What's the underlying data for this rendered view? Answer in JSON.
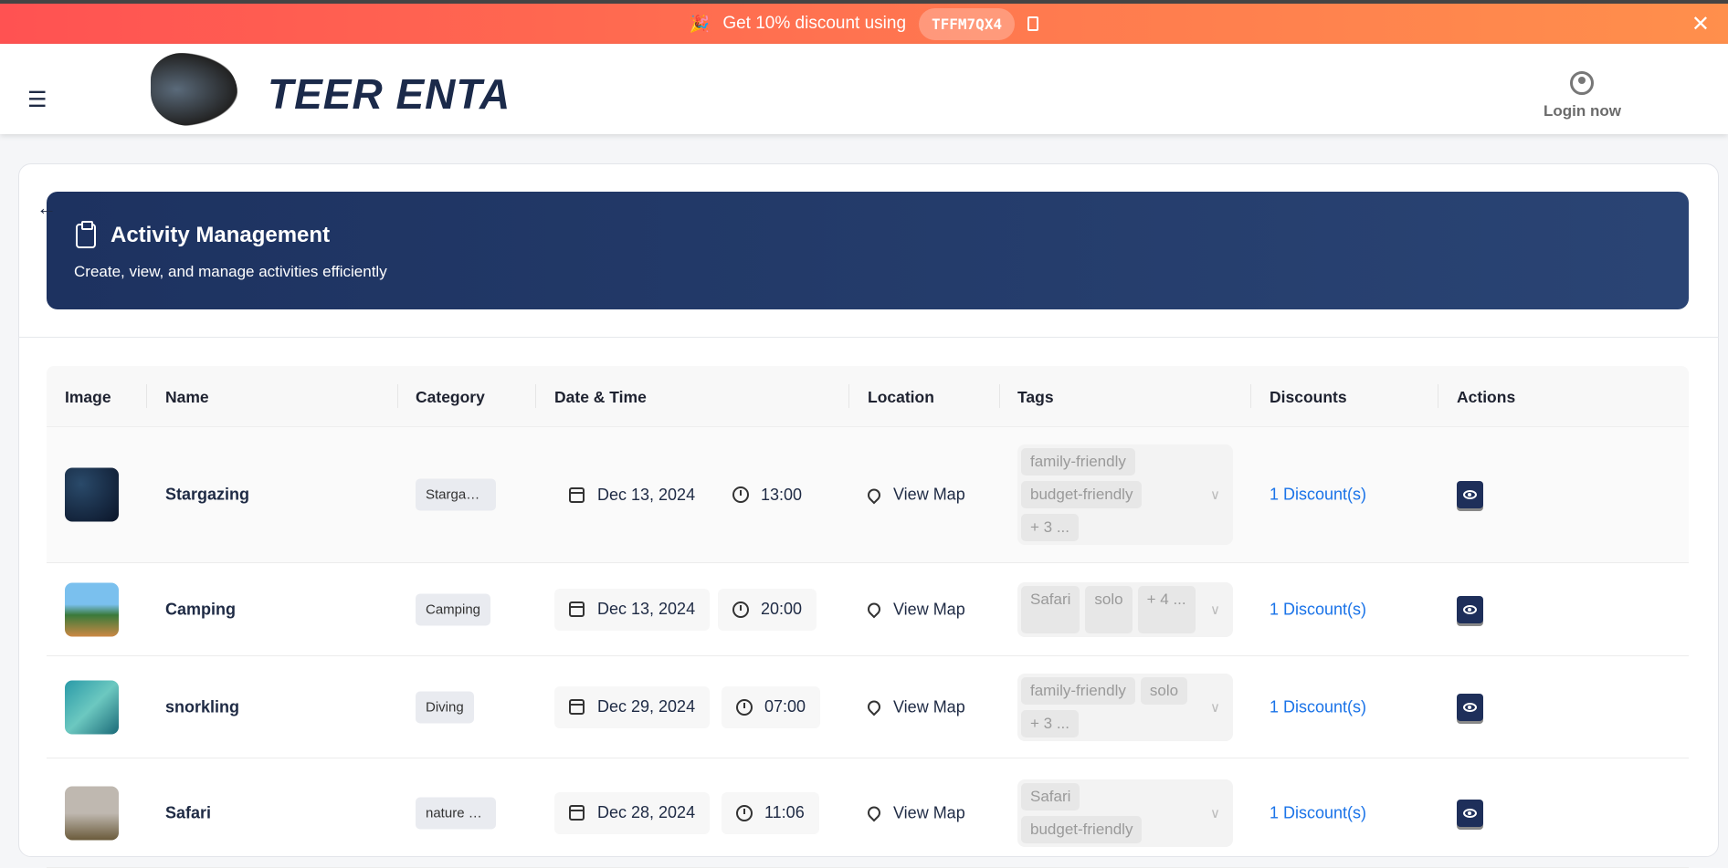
{
  "promo": {
    "text": "Get 10% discount using",
    "code": "TFFM7QX4",
    "close": "✕",
    "gift": "🎉"
  },
  "header": {
    "menu_icon": "☰",
    "logo_text": "TEER ENTA",
    "login": "Login now"
  },
  "page": {
    "back": "←",
    "title": "Activity Management",
    "subtitle": "Create, view, and manage activities efficiently"
  },
  "table": {
    "columns": [
      "Image",
      "Name",
      "Category",
      "Date & Time",
      "Location",
      "Tags",
      "Discounts",
      "Actions"
    ],
    "rows": [
      {
        "name": "Stargazing",
        "category": "Stargazi...",
        "date": "Dec 13, 2024",
        "time": "13:00",
        "location": "View Map",
        "tags": [
          "family-friendly",
          "budget-friendly",
          "+ 3 ..."
        ],
        "discounts": "1 Discount(s)"
      },
      {
        "name": "Camping",
        "category": "Camping",
        "date": "Dec 13, 2024",
        "time": "20:00",
        "location": "View Map",
        "tags": [
          "Safari",
          "solo",
          "+ 4 ..."
        ],
        "discounts": "1 Discount(s)"
      },
      {
        "name": "snorkling",
        "category": "Diving",
        "date": "Dec 29, 2024",
        "time": "07:00",
        "location": "View Map",
        "tags": [
          "family-friendly",
          "solo",
          "+ 3 ..."
        ],
        "discounts": "1 Discount(s)"
      },
      {
        "name": "Safari",
        "category": "nature a...",
        "date": "Dec 28, 2024",
        "time": "11:06",
        "location": "View Map",
        "tags": [
          "Safari",
          "budget-friendly"
        ],
        "discounts": "1 Discount(s)"
      }
    ]
  }
}
